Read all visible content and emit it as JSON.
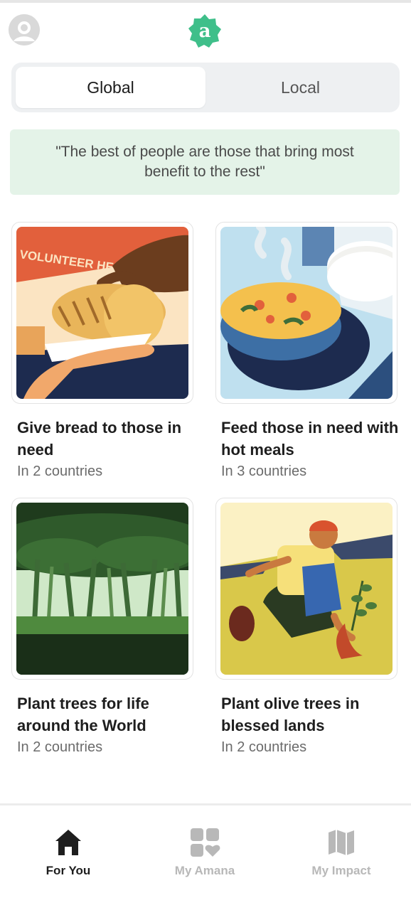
{
  "header": {
    "avatar_icon": "user-avatar-icon",
    "logo_letter": "a",
    "logo_color": "#3fbf8a"
  },
  "segment": {
    "tabs": [
      {
        "label": "Global",
        "active": true
      },
      {
        "label": "Local",
        "active": false
      }
    ]
  },
  "quote": {
    "text": "\"The best of people are those that bring most benefit to the rest\""
  },
  "cards": [
    {
      "title": "Give bread to those in need",
      "subtitle": "In 2 countries",
      "banner_text": "VOLUNTEER HE"
    },
    {
      "title": "Feed those in need with hot meals",
      "subtitle": "In 3 countries"
    },
    {
      "title": "Plant trees for life around the World",
      "subtitle": "In 2 countries"
    },
    {
      "title": "Plant olive trees in blessed lands",
      "subtitle": "In 2 countries"
    }
  ],
  "bottom_nav": {
    "items": [
      {
        "label": "For You",
        "icon": "home-icon",
        "active": true
      },
      {
        "label": "My Amana",
        "icon": "grid-heart-icon",
        "active": false
      },
      {
        "label": "My Impact",
        "icon": "map-icon",
        "active": false
      }
    ]
  },
  "colors": {
    "quote_background": "#e4f3e8",
    "active_nav": "#1e1e1e",
    "inactive_nav": "#b8b8b8"
  }
}
